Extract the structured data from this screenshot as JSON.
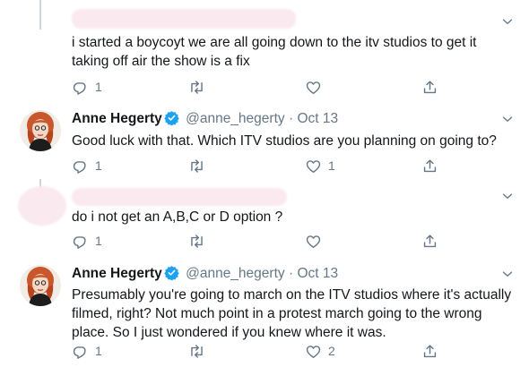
{
  "tweets": [
    {
      "author": null,
      "text": "i started a boycoyt  we are all going down to the itv studios to get it taking off air   the show is a fix",
      "reply_count": "1",
      "retweet_count": "",
      "like_count": ""
    },
    {
      "author": {
        "name": "Anne Hegerty",
        "handle": "@anne_hegerty",
        "separator": "·",
        "date": "Oct 13",
        "verified": true
      },
      "text": "Good luck with that. Which ITV studios are you planning on going to?",
      "reply_count": "1",
      "retweet_count": "",
      "like_count": "1"
    },
    {
      "author": null,
      "text": "do i not get an  A,B,C or D option ?",
      "reply_count": "1",
      "retweet_count": "",
      "like_count": ""
    },
    {
      "author": {
        "name": "Anne Hegerty",
        "handle": "@anne_hegerty",
        "separator": "·",
        "date": "Oct 13",
        "verified": true
      },
      "text": "Presumably you're going to march on the ITV studios where it's actually filmed, right?  Not much point in a protest march going to the wrong place.  So I just wondered if you knew where it was.",
      "reply_count": "1",
      "retweet_count": "",
      "like_count": "2"
    }
  ],
  "icons": {
    "reply": "reply-icon",
    "retweet": "retweet-icon",
    "like": "heart-icon",
    "share": "share-icon",
    "menu": "chevron-down-icon",
    "verified": "verified-badge-icon"
  },
  "colors": {
    "text": "#14171a",
    "secondary": "#657786",
    "verified": "#1da1f2",
    "thread_line": "#ccd6dd"
  }
}
